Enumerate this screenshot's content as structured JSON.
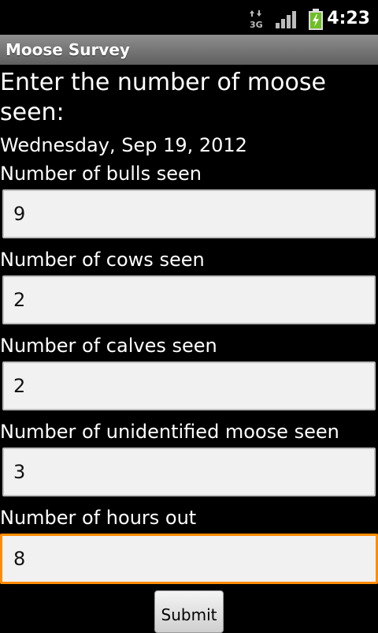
{
  "status": {
    "time": "4:23",
    "network": "3G",
    "icons": [
      "3g-data-icon",
      "signal-icon",
      "battery-charging-icon"
    ]
  },
  "app": {
    "title": "Moose Survey"
  },
  "form": {
    "heading": "Enter the number of moose seen:",
    "date": "Wednesday,  Sep 19, 2012",
    "fields": [
      {
        "label": "Number of bulls seen",
        "value": "9"
      },
      {
        "label": "Number of cows seen",
        "value": "2"
      },
      {
        "label": "Number of calves seen",
        "value": "2"
      },
      {
        "label": "Number of unidentified moose seen",
        "value": "3"
      },
      {
        "label": "Number of hours out",
        "value": "8"
      }
    ],
    "submit_label": "Submit"
  },
  "colors": {
    "focus_border": "#ff8c00",
    "title_bar": "#7a7a7a"
  }
}
